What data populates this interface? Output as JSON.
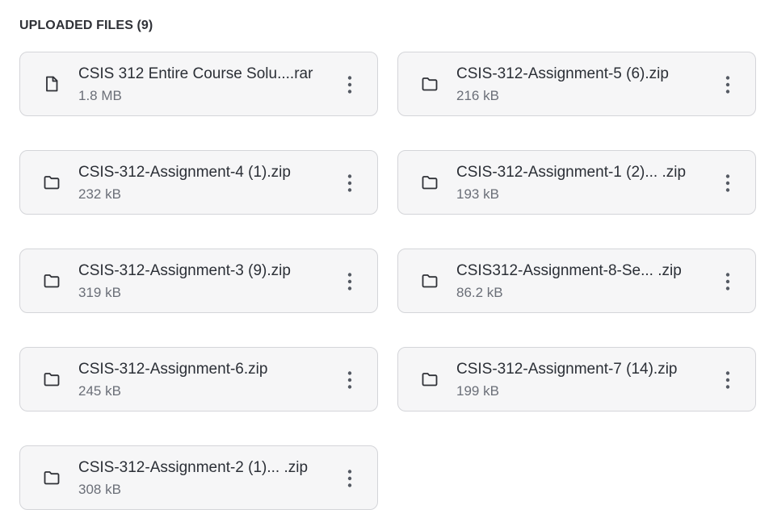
{
  "header": {
    "title": "UPLOADED FILES (9)"
  },
  "files": [
    {
      "name": "CSIS 312 Entire Course Solu....rar",
      "size": "1.8 MB",
      "icon": "file-icon"
    },
    {
      "name": "CSIS-312-Assignment-5 (6).zip",
      "size": "216 kB",
      "icon": "folder-icon"
    },
    {
      "name": "CSIS-312-Assignment-4 (1).zip",
      "size": "232 kB",
      "icon": "folder-icon"
    },
    {
      "name": "CSIS-312-Assignment-1 (2)... .zip",
      "size": "193 kB",
      "icon": "folder-icon"
    },
    {
      "name": "CSIS-312-Assignment-3 (9).zip",
      "size": "319 kB",
      "icon": "folder-icon"
    },
    {
      "name": "CSIS312-Assignment-8-Se... .zip",
      "size": "86.2 kB",
      "icon": "folder-icon"
    },
    {
      "name": "CSIS-312-Assignment-6.zip",
      "size": "245 kB",
      "icon": "folder-icon"
    },
    {
      "name": "CSIS-312-Assignment-7 (14).zip",
      "size": "199 kB",
      "icon": "folder-icon"
    },
    {
      "name": "CSIS-312-Assignment-2 (1)... .zip",
      "size": "308 kB",
      "icon": "folder-icon"
    }
  ],
  "colors": {
    "card_background": "#f6f6f7",
    "card_border": "#d4d5d9",
    "text_primary": "#2b2f36",
    "text_secondary": "#6b6f78"
  }
}
